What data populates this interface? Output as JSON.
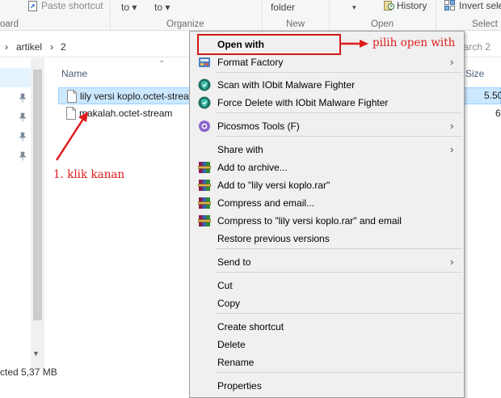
{
  "ribbon": {
    "paste_shortcut": "Paste shortcut",
    "clipboard_group": "oard",
    "move_to": "to ▾",
    "copy_to": "to ▾",
    "organize_group": "Organize",
    "new_folder": "folder",
    "new_group": "New",
    "history": "History",
    "open_group": "Open",
    "invert_selection": "Invert sele",
    "select_group": "Select"
  },
  "address": {
    "segment_1": "artikel",
    "sep_1": "›",
    "segment_2": "2",
    "sep_2": "›",
    "search_placeholder": "earch 2"
  },
  "columns": {
    "name": "Name",
    "size": "Size"
  },
  "files": [
    {
      "name": "lily versi koplo.octet-stream",
      "size": "5.50",
      "selected": true
    },
    {
      "name": "makalah.octet-stream",
      "size": "6",
      "selected": false
    }
  ],
  "status": {
    "text": "cted  5,37 MB"
  },
  "context_menu": {
    "items": [
      {
        "label": "Open with",
        "bold": true,
        "submenu": false
      },
      {
        "label": "Format Factory",
        "submenu": true
      },
      {
        "label": "Scan with IObit Malware Fighter",
        "submenu": false
      },
      {
        "label": "Force Delete with IObit Malware Fighter",
        "submenu": false
      },
      {
        "label": "Picosmos Tools (F)",
        "submenu": true
      },
      {
        "label": "Share with",
        "submenu": true
      },
      {
        "label": "Add to archive...",
        "submenu": false
      },
      {
        "label": "Add to \"lily versi koplo.rar\"",
        "submenu": false
      },
      {
        "label": "Compress and email...",
        "submenu": false
      },
      {
        "label": "Compress to \"lily versi koplo.rar\" and email",
        "submenu": false
      },
      {
        "label": "Restore previous versions",
        "submenu": false
      },
      {
        "label": "Send to",
        "submenu": true
      },
      {
        "label": "Cut",
        "submenu": false
      },
      {
        "label": "Copy",
        "submenu": false
      },
      {
        "label": "Create shortcut",
        "submenu": false
      },
      {
        "label": "Delete",
        "submenu": false
      },
      {
        "label": "Rename",
        "submenu": false
      },
      {
        "label": "Properties",
        "submenu": false
      }
    ],
    "submenu_glyph": "›"
  },
  "annotations": {
    "step_1": "1. klik kanan",
    "step_2": "pilih open with",
    "color": "#e01b1b"
  },
  "icons": {
    "format_factory": "format-factory-icon",
    "iobit": "iobit-shield-icon",
    "picosmos": "picosmos-icon",
    "winrar": "winrar-books-icon"
  }
}
